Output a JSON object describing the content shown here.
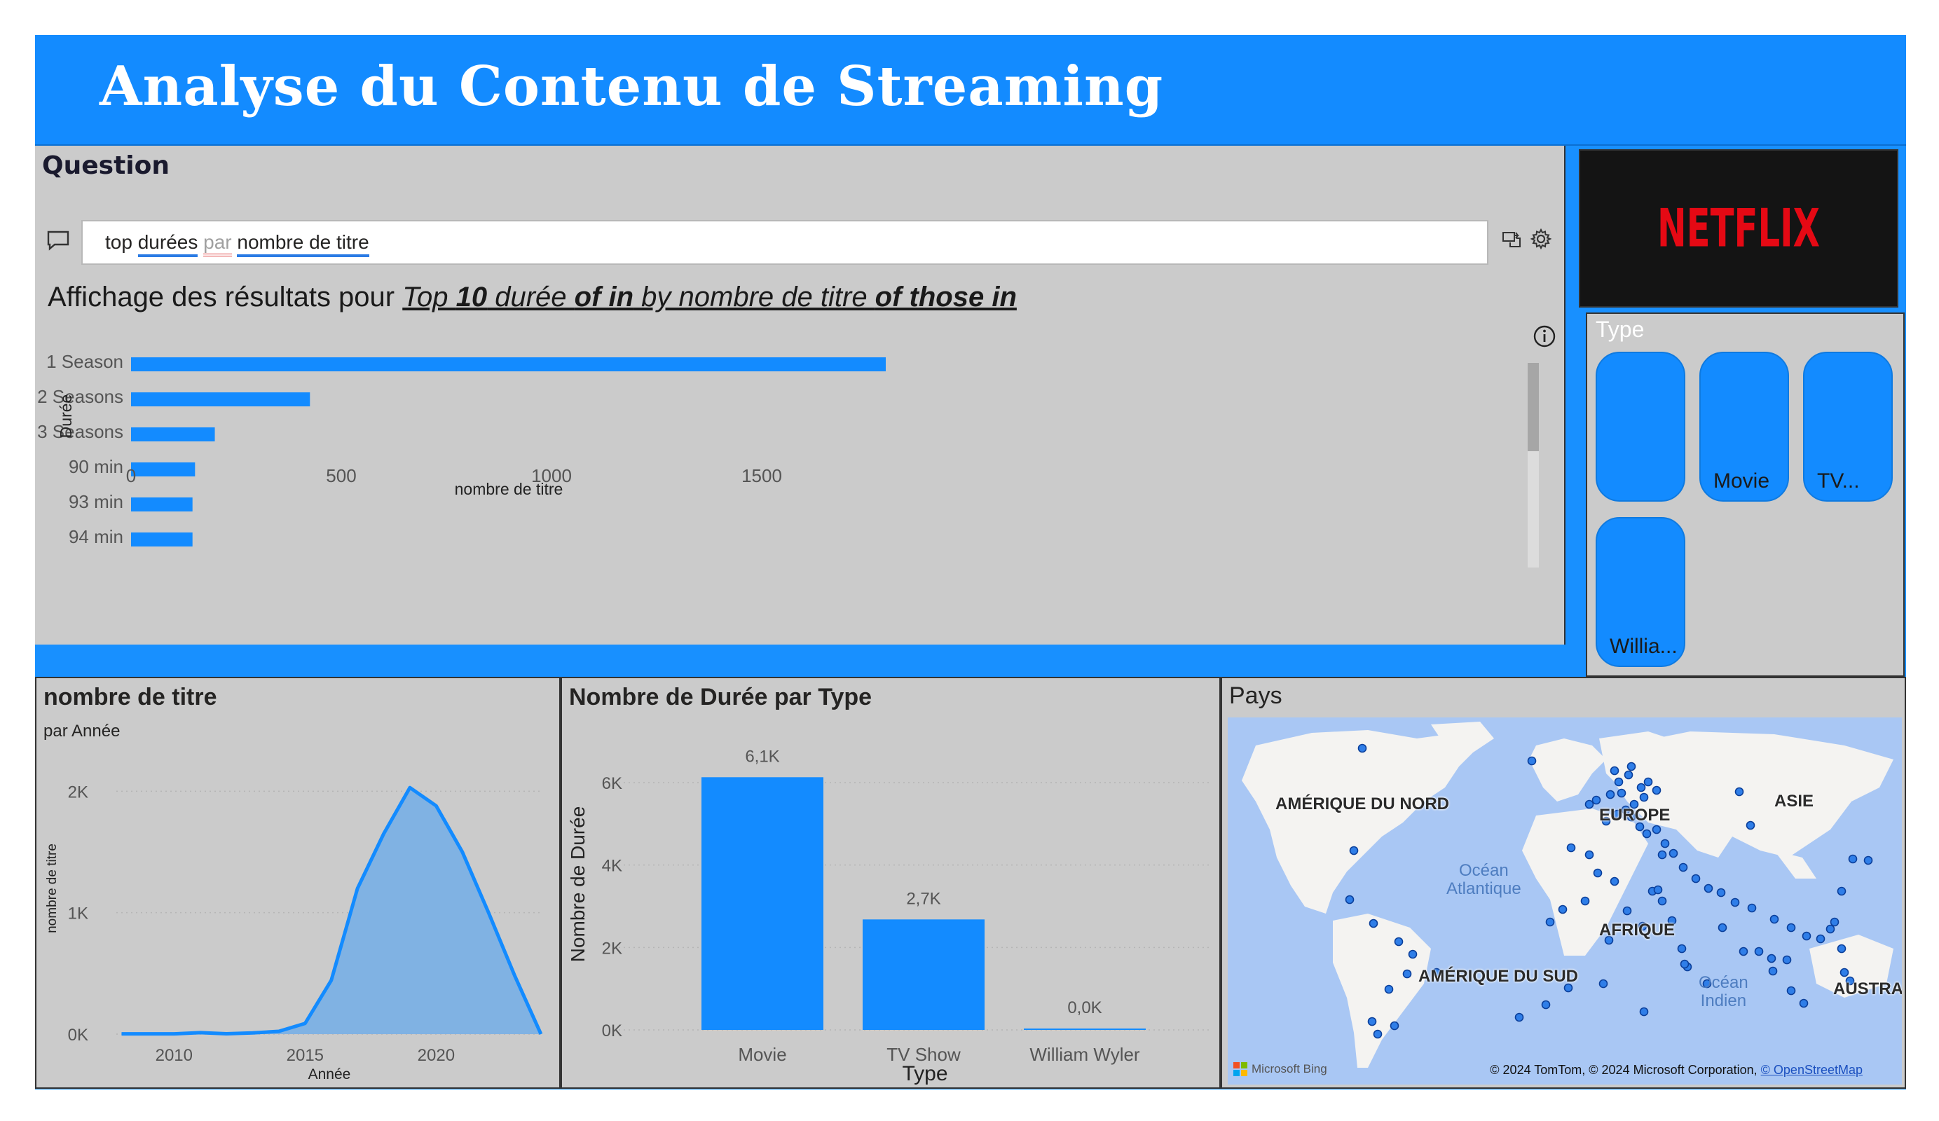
{
  "header": {
    "title": "Analyse du Contenu de Streaming"
  },
  "qa": {
    "title": "Question",
    "query_tokens": [
      "top",
      "durées",
      "par",
      "nombre de titre"
    ],
    "result_prefix": "Affichage des résultats pour ",
    "result_parts": [
      {
        "text": "Top ",
        "bold": false
      },
      {
        "text": "10",
        "bold": true
      },
      {
        "text": " durée ",
        "bold": false
      },
      {
        "text": "of in",
        "bold": true
      },
      {
        "text": " by nombre de titre ",
        "bold": false
      },
      {
        "text": "of those in",
        "bold": true
      }
    ]
  },
  "logo": {
    "text": "NETFLIX",
    "color": "#e50914"
  },
  "type_slicer": {
    "title": "Type",
    "items": [
      "",
      "Movie",
      "TV...",
      "Willia..."
    ]
  },
  "chart_data": [
    {
      "type": "bar",
      "orientation": "horizontal",
      "categories": [
        "1 Season",
        "2 Seasons",
        "3 Seasons",
        "90 min",
        "93 min",
        "94 min"
      ],
      "values": [
        1793,
        425,
        199,
        152,
        146,
        146
      ],
      "xlabel": "nombre de titre",
      "ylabel": "Durée",
      "xticks": [
        0,
        500,
        1000,
        1500
      ],
      "xlim": [
        0,
        1830
      ],
      "color": "#138bff"
    },
    {
      "type": "area",
      "title": "nombre de titre",
      "subtitle": "par Année",
      "x": [
        2008,
        2009,
        2010,
        2011,
        2012,
        2013,
        2014,
        2015,
        2016,
        2017,
        2018,
        2019,
        2020,
        2021,
        2022,
        2023,
        2024
      ],
      "y": [
        2,
        2,
        2,
        12,
        3,
        10,
        23,
        88,
        443,
        1200,
        1650,
        2030,
        1880,
        1500,
        1000,
        480,
        0
      ],
      "xlabel": "Année",
      "ylabel": "nombre de titre",
      "xticks": [
        2010,
        2015,
        2020
      ],
      "yticks": [
        "0K",
        "1K",
        "2K"
      ],
      "ylim": [
        0,
        2400
      ],
      "xlim": [
        2007.8,
        2024
      ],
      "color": "#138bff"
    },
    {
      "type": "bar",
      "title": "Nombre de Durée par Type",
      "categories": [
        "Movie",
        "TV Show",
        "William Wyler"
      ],
      "values": [
        6130,
        2680,
        3
      ],
      "data_labels": [
        "6,1K",
        "2,7K",
        "0,0K"
      ],
      "xlabel": "Type",
      "ylabel": "Nombre de Durée",
      "yticks": [
        "0K",
        "2K",
        "4K",
        "6K"
      ],
      "ylim": [
        0,
        6900
      ],
      "color": "#138bff"
    }
  ],
  "map": {
    "title": "Pays",
    "labels": [
      "AMÉRIQUE DU NORD",
      "EUROPE",
      "ASIE",
      "AFRIQUE",
      "AMÉRIQUE DU SUD",
      "AUSTRA"
    ],
    "oceans": [
      "Océan\nAtlantique",
      "Océan\nIndien"
    ],
    "credit": "© 2024 TomTom, © 2024 Microsoft Corporation, ",
    "credit_link": "© OpenStreetMap",
    "bing": "Microsoft Bing"
  }
}
